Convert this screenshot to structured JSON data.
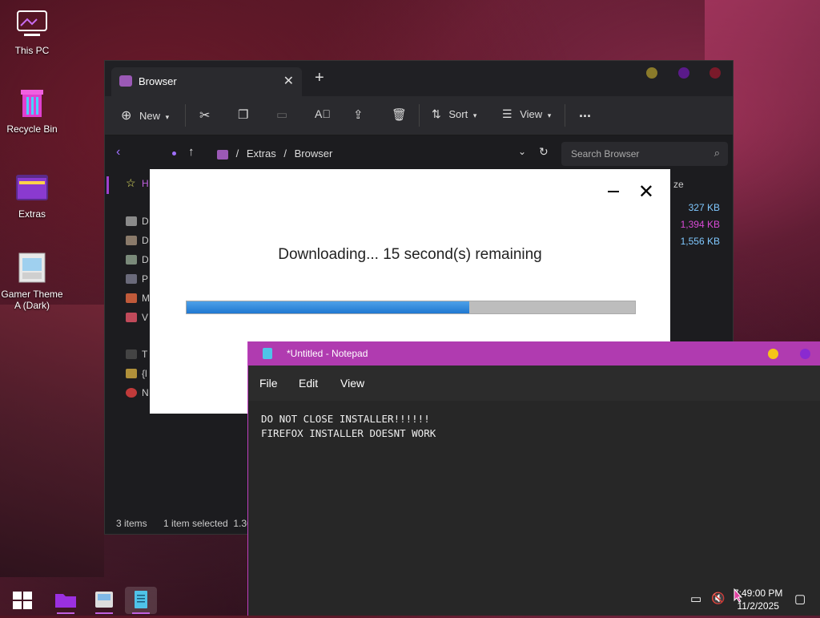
{
  "desktop": {
    "icons": [
      {
        "label": "This PC"
      },
      {
        "label": "Recycle Bin"
      },
      {
        "label": "Extras"
      },
      {
        "label": "Gamer Theme A (Dark)"
      }
    ]
  },
  "explorer": {
    "tab_title": "Browser",
    "toolbar": {
      "new": "New",
      "sort": "Sort",
      "view": "View",
      "more": "..."
    },
    "breadcrumb": [
      "Extras",
      "Browser"
    ],
    "search_placeholder": "Search Browser",
    "size_header": "ze",
    "nav_items": [
      "H",
      "D",
      "D",
      "D",
      "P",
      "M",
      "V",
      "T",
      "{l",
      "N"
    ],
    "sizes": [
      {
        "value": "327 KB",
        "color": "#7fc8ff"
      },
      {
        "value": "1,394 KB",
        "color": "#d94ad6"
      },
      {
        "value": "1,556 KB",
        "color": "#7fc8ff"
      }
    ],
    "status": {
      "items": "3 items",
      "selected": "1 item selected  1.36"
    }
  },
  "installer": {
    "message": "Downloading... 15 second(s) remaining",
    "progress": 0.63
  },
  "notepad": {
    "title": "*Untitled - Notepad",
    "menu": [
      "File",
      "Edit",
      "View"
    ],
    "lines": [
      "DO NOT CLOSE INSTALLER!!!!!!",
      "FIREFOX INSTALLER DOESNT WORK"
    ]
  },
  "taskbar": {
    "time": "7:49:00 PM",
    "date": "11/2/2025"
  },
  "colors": {
    "accent": "#b03bb0",
    "progress": "#2b86dc",
    "purple_tab": "#9b59b6"
  }
}
